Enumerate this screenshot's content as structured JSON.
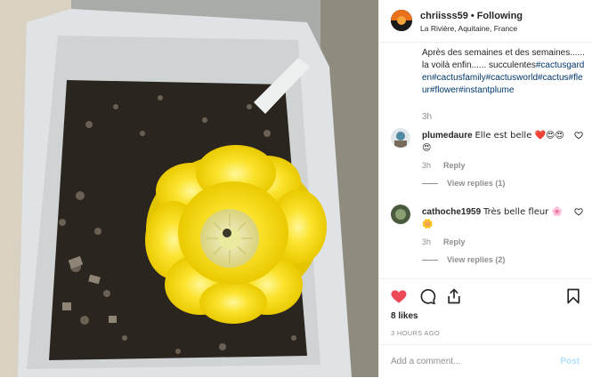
{
  "post": {
    "username": "chriisss59",
    "separator": "•",
    "follow_label": "Following",
    "location": "La Rivière, Aquitaine, France",
    "caption_text": "Après des semaines et des semaines...... la voilà enfin...... succulentes",
    "caption_tags": "#cactusgarden#cactusfamily#cactusworld#cactus#fleur#flower#instantplume",
    "caption_time": "3h"
  },
  "comments": [
    {
      "username": "plumedaure",
      "text": "Elle est belle ❤️😍😍😍",
      "time": "3h",
      "reply_label": "Reply",
      "replies_label": "View replies (1)"
    },
    {
      "username": "cathoche1959",
      "text": "Très belle fleur 🌸🌼",
      "time": "3h",
      "reply_label": "Reply",
      "replies_label": "View replies (2)"
    }
  ],
  "stats": {
    "likes": "8 likes",
    "timestamp": "3 HOURS AGO"
  },
  "composer": {
    "placeholder": "Add a comment...",
    "post_label": "Post"
  },
  "icons": {
    "like": "heart-filled-icon",
    "comment": "comment-icon",
    "share": "share-icon",
    "save": "bookmark-icon",
    "comment_like": "heart-outline-icon"
  },
  "colors": {
    "like_red": "#ed4956",
    "link_blue": "#00376b",
    "muted_gray": "#8e8e8e",
    "post_blue": "#b2dffc"
  }
}
